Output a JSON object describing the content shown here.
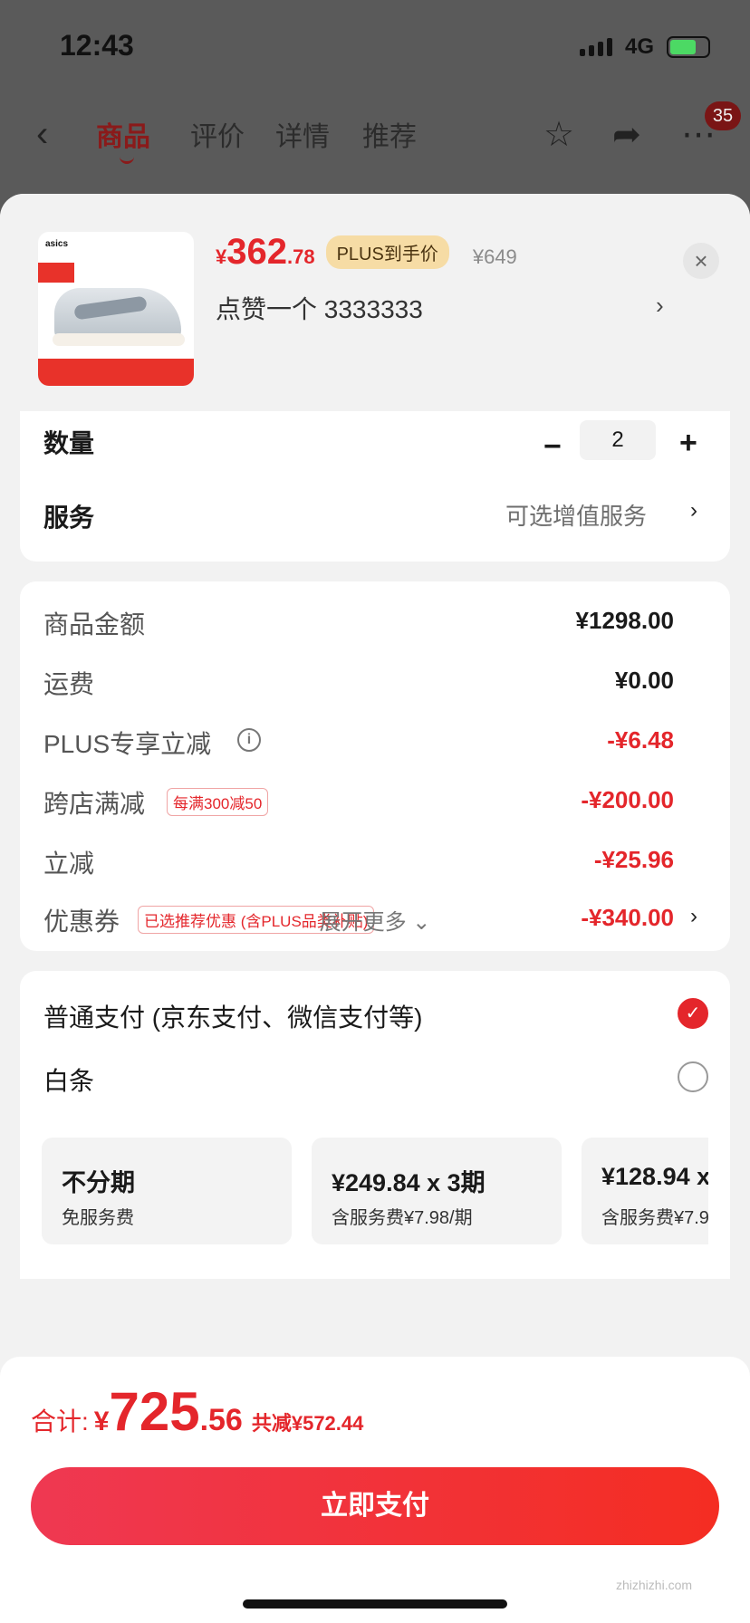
{
  "status_bar": {
    "time": "12:43",
    "network": "4G"
  },
  "nav": {
    "tabs": [
      "商品",
      "评价",
      "详情",
      "推荐"
    ],
    "active_tab": "商品",
    "badge": "35"
  },
  "product": {
    "price_currency": "¥",
    "price_int": "362",
    "price_dec": ".78",
    "plus_label": "PLUS到手价",
    "original_price": "¥649",
    "spec": "点赞一个  3333333",
    "brand": "asics"
  },
  "quantity": {
    "label": "数量",
    "value": "2"
  },
  "service": {
    "label": "服务",
    "value": "可选增值服务"
  },
  "fees": {
    "goods": {
      "label": "商品金额",
      "value": "¥1298.00"
    },
    "shipping": {
      "label": "运费",
      "value": "¥0.00"
    },
    "plus_off": {
      "label": "PLUS专享立减",
      "value": "-¥6.48"
    },
    "cross_store": {
      "label": "跨店满减",
      "tag": "每满300减50",
      "value": "-¥200.00"
    },
    "instant": {
      "label": "立减",
      "value": "-¥25.96"
    },
    "coupon": {
      "label": "优惠券",
      "tag": "已选推荐优惠 (含PLUS品类补贴)",
      "value": "-¥340.00"
    },
    "more": "展开更多"
  },
  "payment": {
    "normal": "普通支付 (京东支付、微信支付等)",
    "baitiao": "白条",
    "plans": [
      {
        "title": "不分期",
        "sub": "免服务费"
      },
      {
        "title": "¥249.84 x 3期",
        "sub": "含服务费¥7.98/期"
      },
      {
        "title": "¥128.94 x",
        "sub": "含服务费¥7.9"
      }
    ]
  },
  "footer": {
    "total_label": "合计:",
    "total_cur": "¥",
    "total_int": "725",
    "total_dec": ".56",
    "total_save": "共减¥572.44",
    "pay_button": "立即支付",
    "watermark": "zhizhizhi.com"
  },
  "colors": {
    "accent": "#e4262b",
    "plus_pill": "#f6dca5"
  }
}
